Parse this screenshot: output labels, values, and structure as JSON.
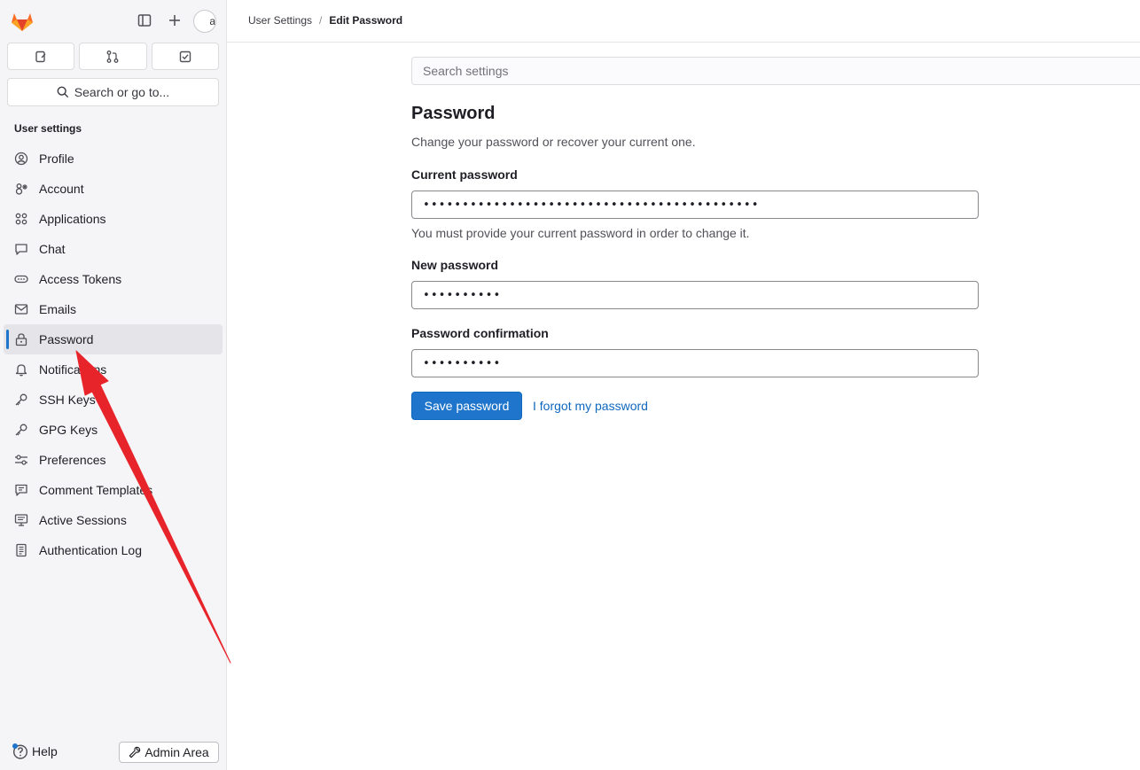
{
  "sidebar": {
    "top": {
      "avatar_text": "a"
    },
    "search_label": "Search or go to...",
    "section_title": "User settings",
    "items": [
      {
        "label": "Profile",
        "icon": "profile-icon",
        "active": false
      },
      {
        "label": "Account",
        "icon": "account-icon",
        "active": false
      },
      {
        "label": "Applications",
        "icon": "applications-icon",
        "active": false
      },
      {
        "label": "Chat",
        "icon": "chat-icon",
        "active": false
      },
      {
        "label": "Access Tokens",
        "icon": "token-icon",
        "active": false
      },
      {
        "label": "Emails",
        "icon": "mail-icon",
        "active": false
      },
      {
        "label": "Password",
        "icon": "lock-icon",
        "active": true
      },
      {
        "label": "Notifications",
        "icon": "bell-icon",
        "active": false
      },
      {
        "label": "SSH Keys",
        "icon": "key-icon",
        "active": false
      },
      {
        "label": "GPG Keys",
        "icon": "key-icon",
        "active": false
      },
      {
        "label": "Preferences",
        "icon": "preferences-icon",
        "active": false
      },
      {
        "label": "Comment Templates",
        "icon": "comment-icon",
        "active": false
      },
      {
        "label": "Active Sessions",
        "icon": "monitor-icon",
        "active": false
      },
      {
        "label": "Authentication Log",
        "icon": "log-icon",
        "active": false
      }
    ],
    "help_label": "Help",
    "admin_label": "Admin Area"
  },
  "breadcrumb": {
    "parent": "User Settings",
    "separator": "/",
    "current": "Edit Password"
  },
  "main": {
    "search_placeholder": "Search settings",
    "title": "Password",
    "description": "Change your password or recover your current one.",
    "current_password": {
      "label": "Current password",
      "value": "•••••••••••••••••••••••••••••••••••••••••••",
      "help": "You must provide your current password in order to change it."
    },
    "new_password": {
      "label": "New password",
      "value": "••••••••••"
    },
    "confirmation": {
      "label": "Password confirmation",
      "value": "••••••••••"
    },
    "save_label": "Save password",
    "forgot_label": "I forgot my password"
  },
  "colors": {
    "accent": "#1f75cb",
    "annotation_arrow": "#e8242b"
  }
}
